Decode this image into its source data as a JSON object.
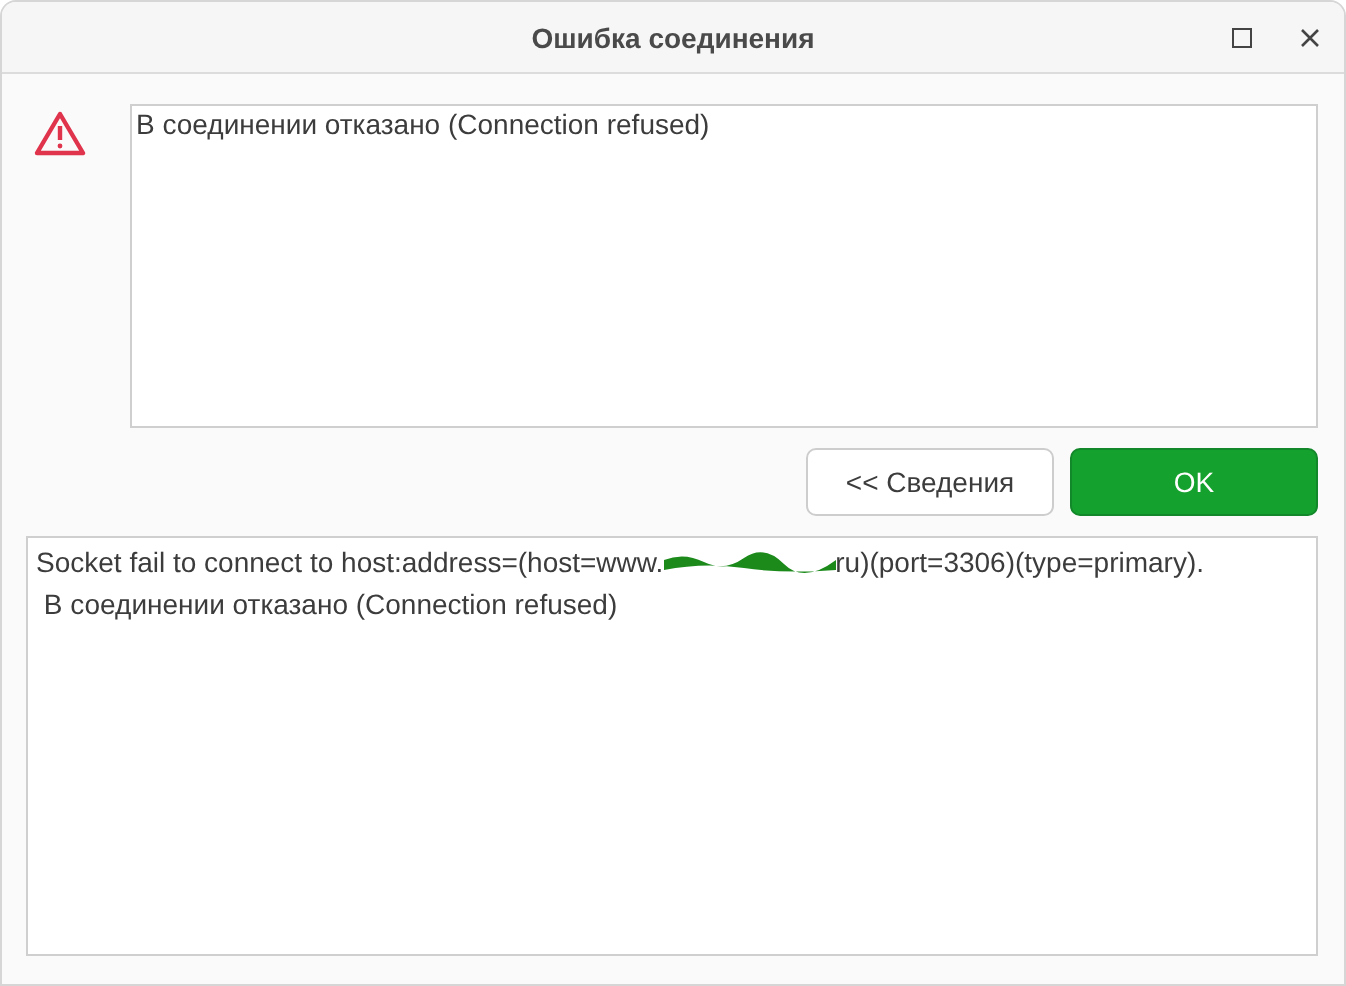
{
  "window": {
    "title": "Ошибка соединения",
    "controls": [
      {
        "kind": "maximize"
      },
      {
        "kind": "close"
      }
    ]
  },
  "message": {
    "kind": "warning",
    "text": "В соединении отказано (Connection refused)"
  },
  "buttons": [
    {
      "label": "<< Сведения",
      "kind": "secondary"
    },
    {
      "label": "OK",
      "kind": "primary"
    }
  ],
  "details": [
    {
      "kind": "redacted",
      "before": "Socket fail to connect to host:address=(host=www.",
      "after": "ru)(port=3306)(type=primary)."
    },
    {
      "kind": "plain",
      "text": " В соединении отказано (Connection refused)"
    }
  ]
}
